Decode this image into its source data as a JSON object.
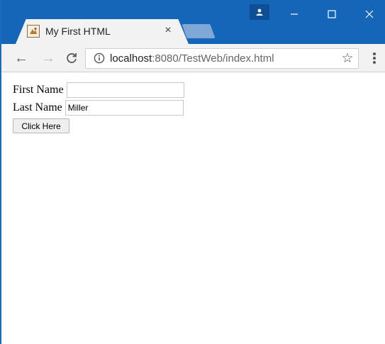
{
  "browser": {
    "tab": {
      "title": "My First HTML",
      "close_glyph": "×",
      "favicon": "html-image-icon"
    },
    "window_controls": {
      "minimize": "—",
      "maximize": "☐",
      "close": "✕"
    },
    "address_bar": {
      "host": "localhost",
      "rest": ":8080/TestWeb/index.html"
    },
    "icons": {
      "back": "←",
      "forward": "→",
      "reload": "C",
      "bookmark": "☆"
    },
    "colors": {
      "titlebar": "#1565b8",
      "tab_active": "#f2f2f2",
      "toolbar": "#f2f2f2"
    }
  },
  "form": {
    "first_name": {
      "label": "First Name",
      "value": ""
    },
    "last_name": {
      "label": "Last Name",
      "value": "Miller"
    },
    "submit_label": "Click Here"
  }
}
